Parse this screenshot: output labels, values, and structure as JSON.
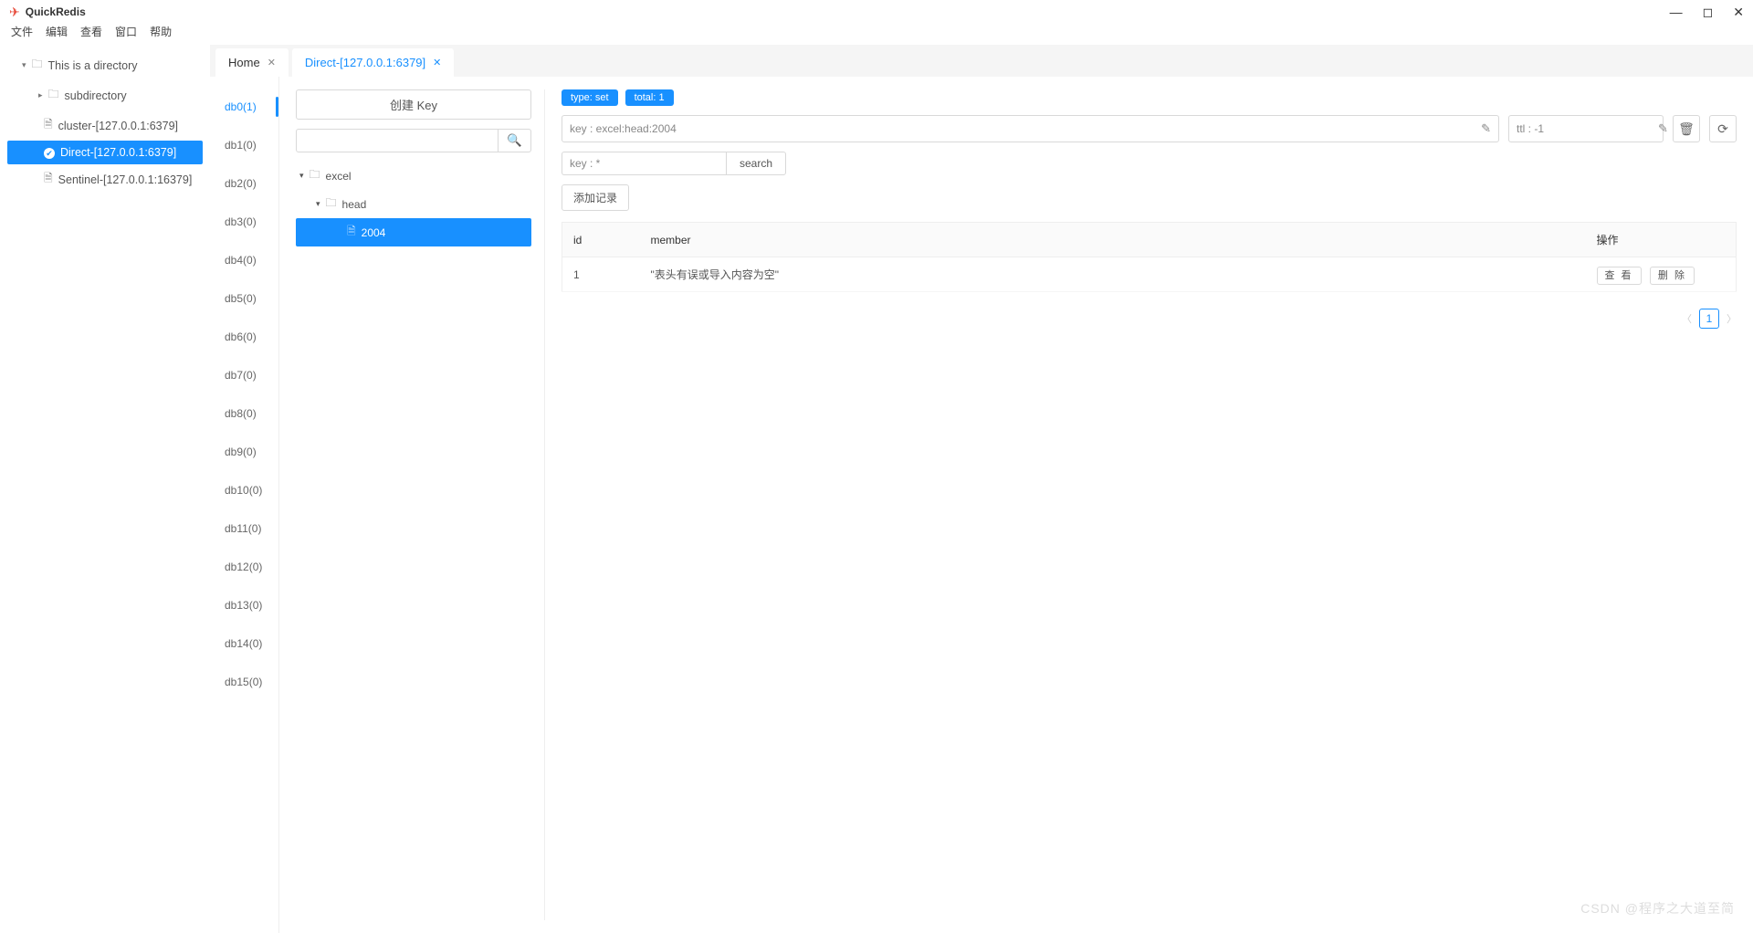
{
  "app": {
    "title": "QuickRedis"
  },
  "menu": {
    "file": "文件",
    "edit": "编辑",
    "view": "查看",
    "window": "窗口",
    "help": "帮助"
  },
  "sidebar": {
    "root": "This is a directory",
    "sub": "subdirectory",
    "items": [
      "cluster-[127.0.0.1:6379]",
      "Direct-[127.0.0.1:6379]",
      "Sentinel-[127.0.0.1:16379]"
    ]
  },
  "tabs": {
    "home": "Home",
    "active": "Direct-[127.0.0.1:6379]"
  },
  "dbs": [
    "db0(1)",
    "db1(0)",
    "db2(0)",
    "db3(0)",
    "db4(0)",
    "db5(0)",
    "db6(0)",
    "db7(0)",
    "db8(0)",
    "db9(0)",
    "db10(0)",
    "db11(0)",
    "db12(0)",
    "db13(0)",
    "db14(0)",
    "db15(0)"
  ],
  "keypanel": {
    "create": "创建 Key",
    "tree": {
      "l0": "excel",
      "l1": "head",
      "l2": "2004"
    }
  },
  "detail": {
    "badge_type": "type: set",
    "badge_total": "total: 1",
    "key_value": "key : excel:head:2004",
    "ttl_value": "ttl : -1",
    "filter_value": "key : *",
    "search_btn": "search",
    "add_record": "添加记录",
    "table": {
      "col_id": "id",
      "col_member": "member",
      "col_action": "操作",
      "row1_id": "1",
      "row1_member": "\"表头有误或导入内容为空\"",
      "view_btn": "查 看",
      "delete_btn": "删 除"
    },
    "page": "1"
  },
  "watermark": "CSDN @程序之大道至简"
}
